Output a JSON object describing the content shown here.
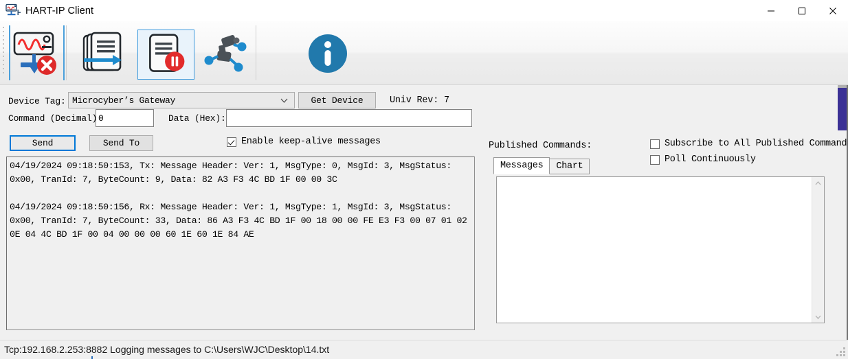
{
  "window": {
    "title": "HART-IP Client",
    "icon": "hart-device-icon",
    "controls": {
      "minimize": "minimize-icon",
      "maximize": "maximize-icon",
      "close": "close-icon"
    }
  },
  "toolbar": {
    "buttons": [
      {
        "name": "disconnect-device-button",
        "icon": "oscilloscope-disconnect-icon",
        "tooltip": "Disconnect",
        "selected": false
      },
      {
        "name": "start-logging-button",
        "icon": "documents-export-icon",
        "tooltip": "Start Logging",
        "selected": false
      },
      {
        "name": "pause-logging-button",
        "icon": "document-pause-icon",
        "tooltip": "Pause Logging",
        "selected": true
      },
      {
        "name": "network-devices-button",
        "icon": "network-nodes-icon",
        "tooltip": "Devices",
        "selected": false
      },
      {
        "name": "about-button",
        "icon": "info-icon",
        "tooltip": "About",
        "selected": false
      }
    ]
  },
  "form": {
    "device_tag_label": "Device Tag:",
    "device_tag_value": "Microcyber’s Gateway",
    "get_device_label": "Get Device",
    "univ_rev_label": "Univ Rev: 7",
    "command_label": "Command (Decimal)",
    "command_value": "0",
    "data_hex_label": "Data (Hex):",
    "data_hex_value": "",
    "send_label": "Send",
    "send_to_label": "Send To",
    "keep_alive_label": "Enable keep-alive messages",
    "keep_alive_checked": true
  },
  "log": {
    "lines": [
      "04/19/2024 09:18:50:153, Tx: Message Header: Ver: 1, MsgType: 0, MsgId: 3, MsgStatus:",
      "0x00, TranId: 7, ByteCount: 9, Data: 82 A3 F3 4C BD 1F 00 00 3C",
      "",
      "04/19/2024 09:18:50:156, Rx: Message Header: Ver: 1, MsgType: 1, MsgId: 3, MsgStatus:",
      "0x00, TranId: 7, ByteCount: 33, Data: 86 A3 F3 4C BD 1F 00 18 00 00 FE E3 F3 00 07 01 02",
      "0E 04 4C BD 1F 00 04 00 00 00 60 1E 60 1E 84 AE"
    ]
  },
  "published": {
    "title": "Published Commands:",
    "tabs": [
      {
        "label": "Messages",
        "active": true
      },
      {
        "label": "Chart",
        "active": false
      }
    ],
    "content": "",
    "subscribe_label": "Subscribe to All Published Commands",
    "subscribe_checked": false,
    "poll_label": "Poll Continuously",
    "poll_checked": false
  },
  "status": {
    "text": "Tcp:192.168.2.253:8882  Logging messages to C:\\Users\\WJC\\Desktop\\14.txt"
  },
  "colors": {
    "accent": "#0078d7",
    "toolbar_separator": "#4a9fdb",
    "scroll_thumb": "#3b3195",
    "info_blue": "#2179ac",
    "alert_red": "#e02020"
  }
}
